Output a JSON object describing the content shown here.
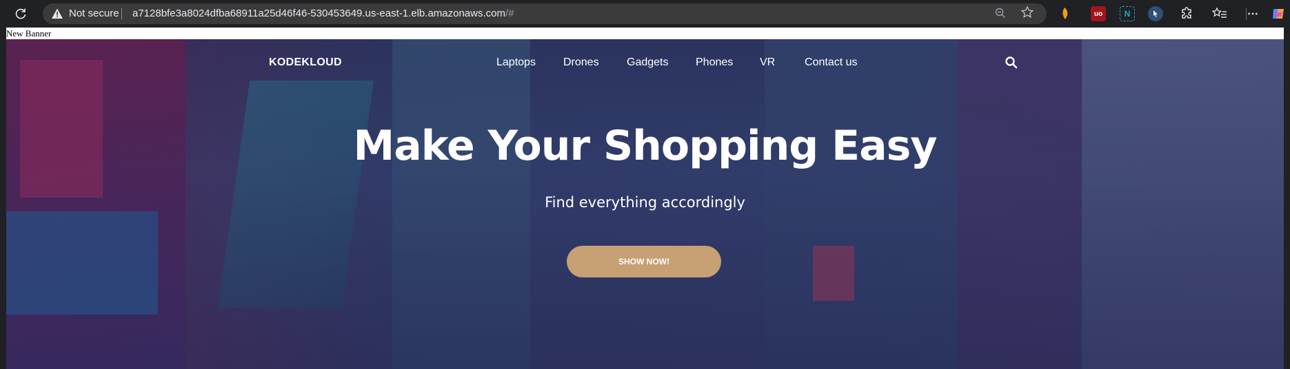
{
  "browser": {
    "security_label": "Not secure",
    "url_main": "a7128bfe3a8024dfba68911a25d46f46-530453649.us-east-1.elb.amazonaws.com",
    "url_suffix": "/#",
    "icons": [
      "refresh-icon",
      "warning-icon",
      "zoom-out-icon",
      "favorite-star-icon",
      "extension-icons",
      "puzzle-icon",
      "favorites-list-icon",
      "more-icon",
      "copilot-icon"
    ]
  },
  "page": {
    "banner_text": "New Banner",
    "logo": "KODEKLOUD",
    "nav": [
      "Laptops",
      "Drones",
      "Gadgets",
      "Phones",
      "VR",
      "Contact us"
    ],
    "headline": "Make Your Shopping Easy",
    "subheadline": "Find everything accordingly",
    "cta_label": "SHOW NOW!",
    "colors": {
      "cta_bg": "#c7a074",
      "hero_tint": "#3a4a78"
    }
  }
}
